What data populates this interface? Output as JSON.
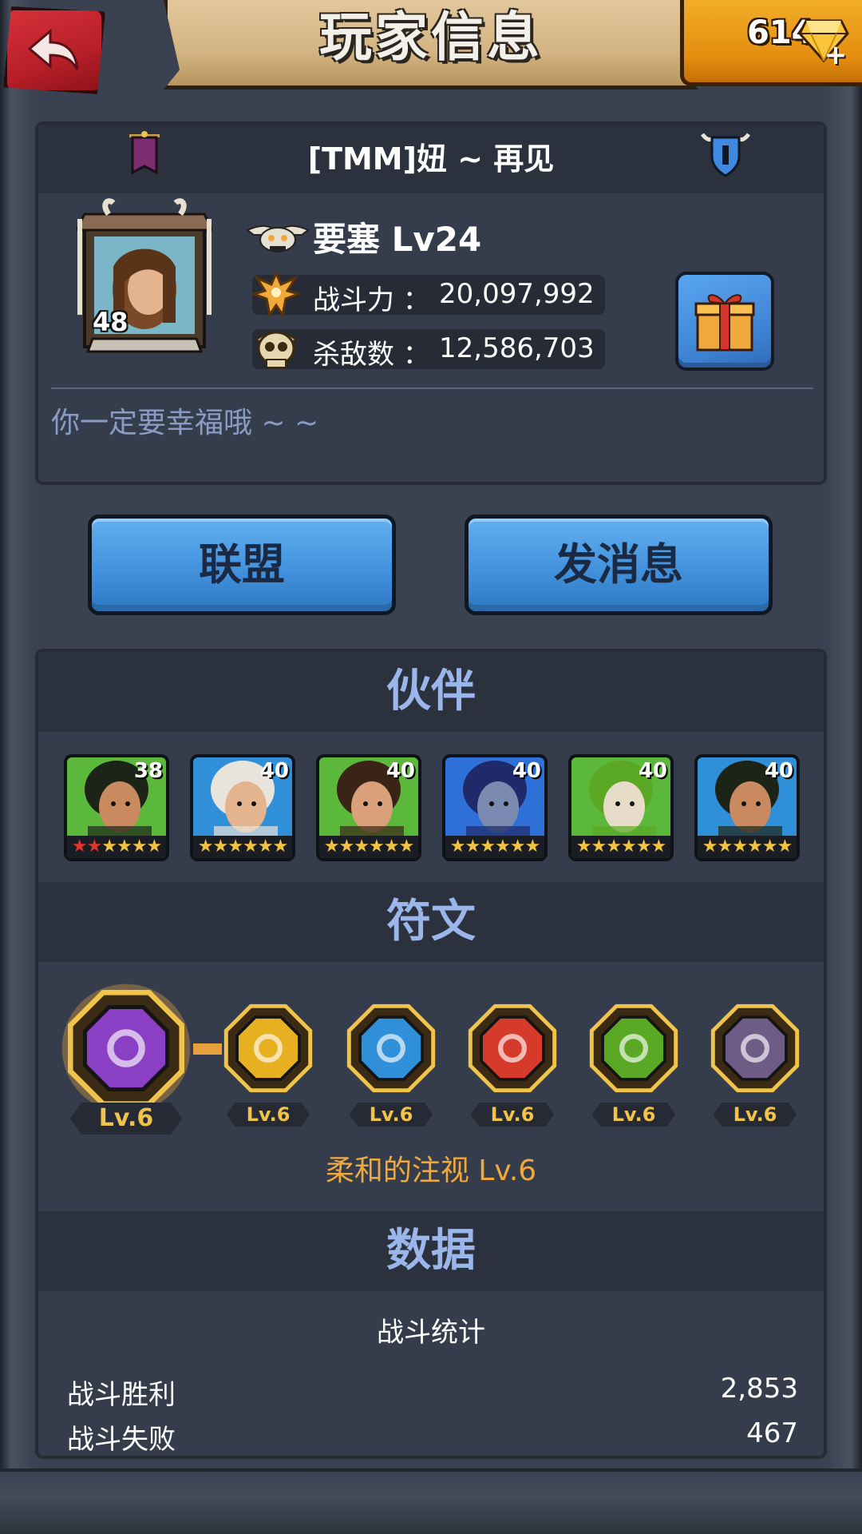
{
  "header": {
    "title": "玩家信息",
    "gems": "614",
    "back_icon": "back-arrow-icon",
    "gem_icon": "diamond-icon"
  },
  "player": {
    "name": "[TMM]妞 ~ 再见",
    "level": "48",
    "fortress": "要塞 Lv24",
    "power_label": "战斗力 ：",
    "power_value": "20,097,992",
    "kills_label": "杀敌数 ：",
    "kills_value": "12,586,703",
    "motto": "你一定要幸福哦 ~ ~"
  },
  "actions": {
    "alliance": "联盟",
    "message": "发消息"
  },
  "partners": {
    "title": "伙伴",
    "heroes": [
      {
        "level": "38",
        "red_stars": 2,
        "stars": 6
      },
      {
        "level": "40",
        "red_stars": 0,
        "stars": 6
      },
      {
        "level": "40",
        "red_stars": 0,
        "stars": 6
      },
      {
        "level": "40",
        "red_stars": 0,
        "stars": 6
      },
      {
        "level": "40",
        "red_stars": 0,
        "stars": 6
      },
      {
        "level": "40",
        "red_stars": 0,
        "stars": 6
      }
    ]
  },
  "runes": {
    "title": "符文",
    "items": [
      {
        "level": "Lv.6",
        "color": "#8a3fc4"
      },
      {
        "level": "Lv.6",
        "color": "#e6b021"
      },
      {
        "level": "Lv.6",
        "color": "#2f8fd8"
      },
      {
        "level": "Lv.6",
        "color": "#d63a2a"
      },
      {
        "level": "Lv.6",
        "color": "#5aa824"
      },
      {
        "level": "Lv.6",
        "color": "#6e5b86"
      }
    ],
    "selected_name": "柔和的注视 Lv.6"
  },
  "stats": {
    "title": "数据",
    "subtitle": "战斗统计",
    "rows": [
      {
        "label": "战斗胜利",
        "value": "2,853"
      },
      {
        "label": "战斗失败",
        "value": "467"
      }
    ]
  },
  "colors": {
    "accent_gold": "#f0a93c",
    "section_title": "#9bb6ea",
    "panel": "#353c4b"
  }
}
